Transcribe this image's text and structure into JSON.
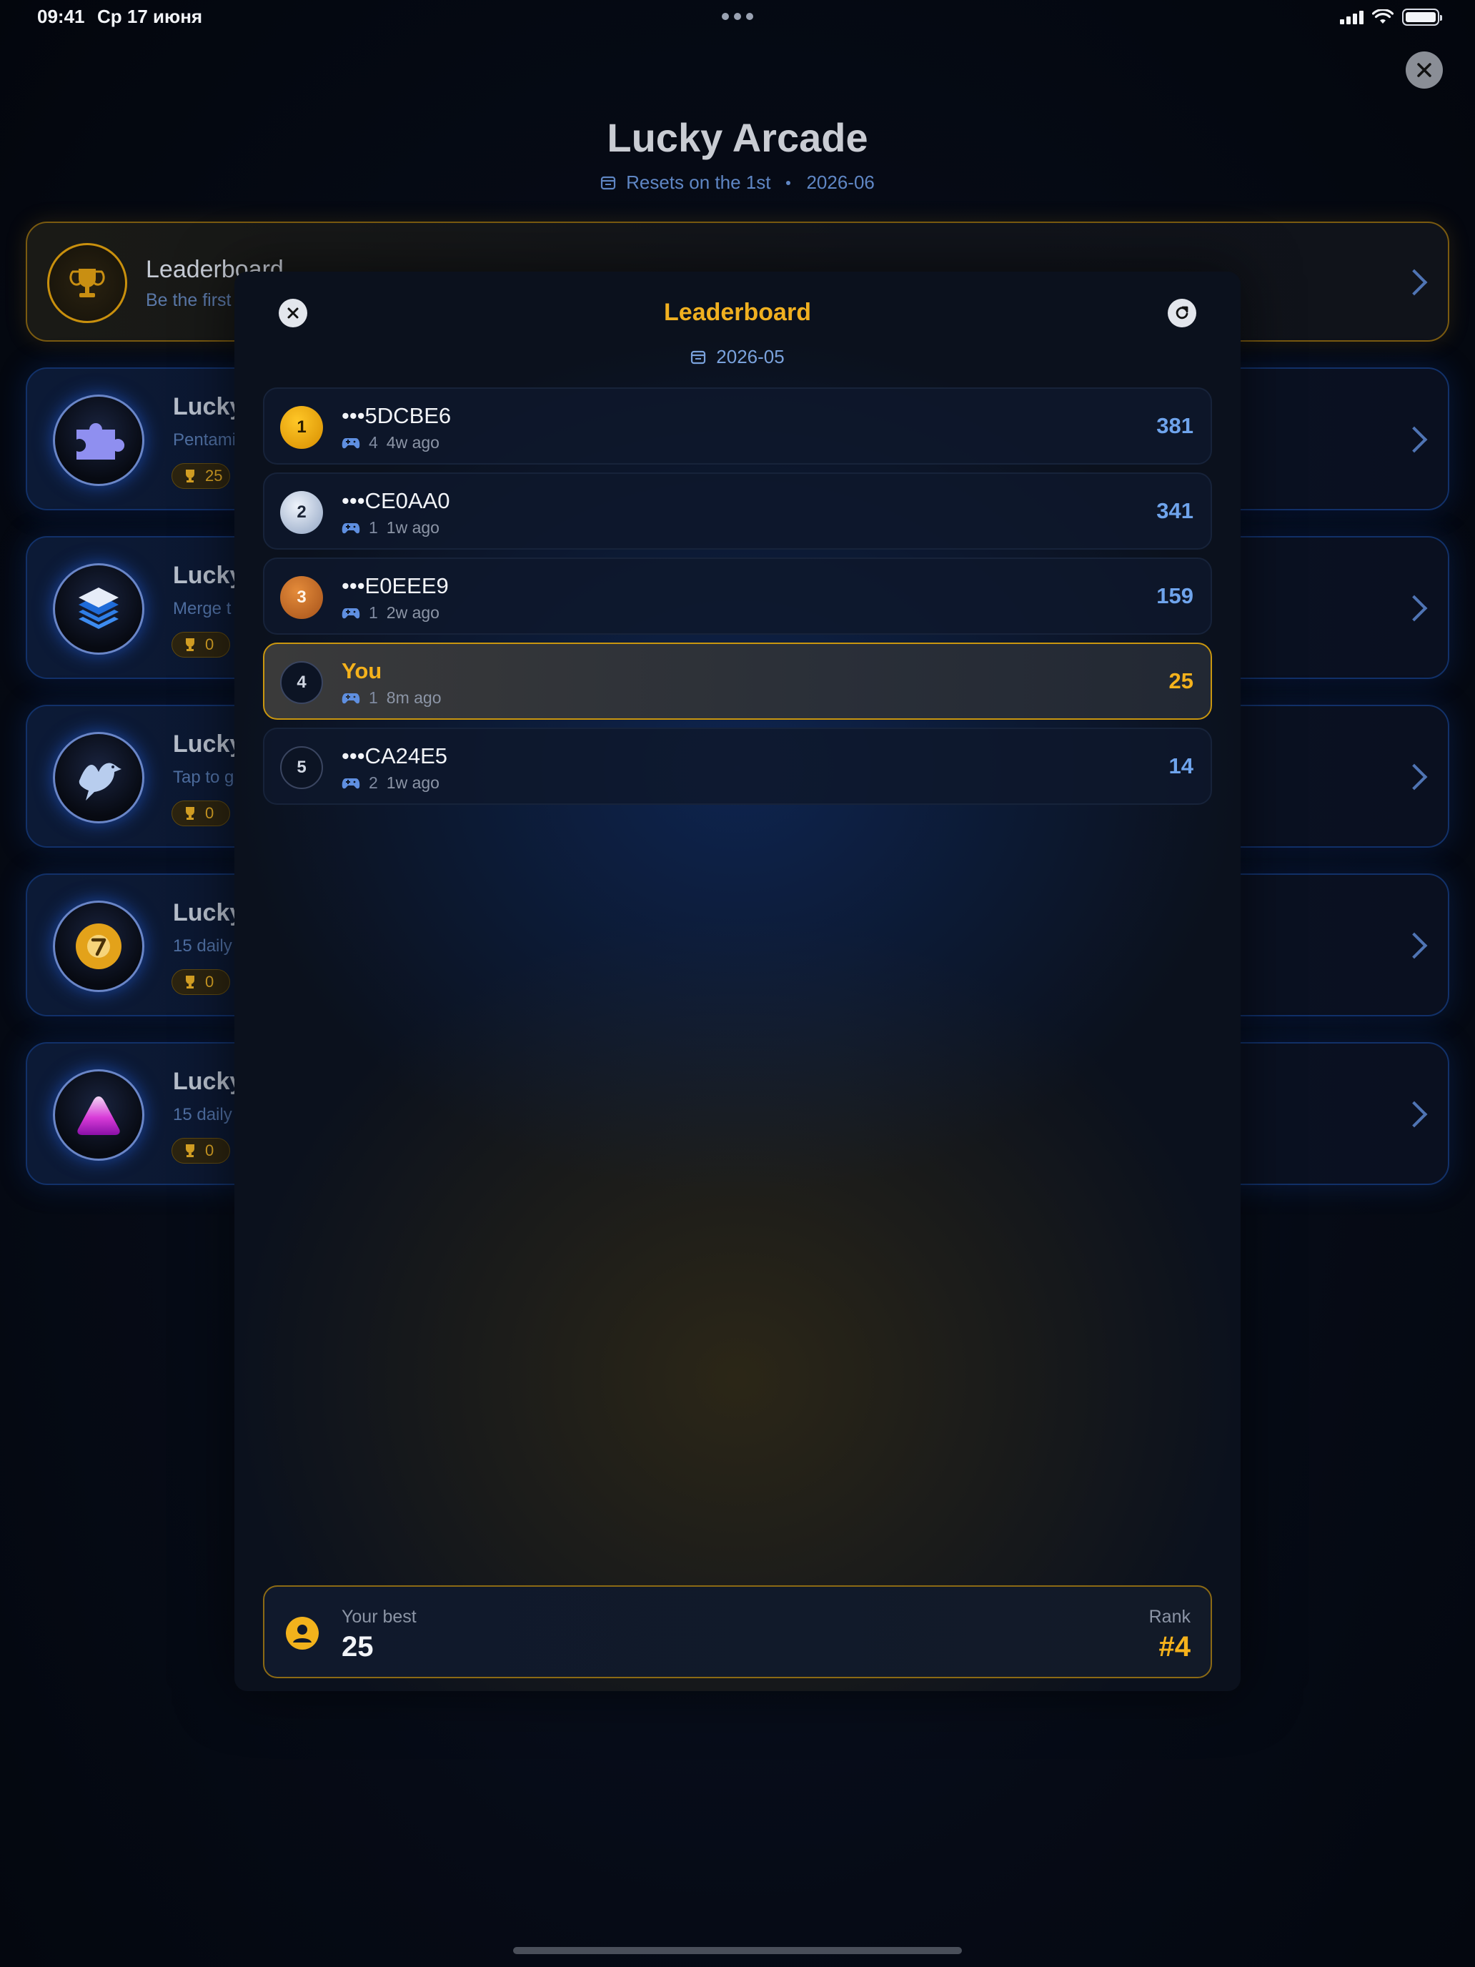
{
  "status_bar": {
    "time": "09:41",
    "date": "Ср 17 июня",
    "battery_level": 1.0
  },
  "page": {
    "title": "Lucky Arcade",
    "resets_label": "Resets on the 1st",
    "current_period": "2026-06"
  },
  "leaderboard_card": {
    "title": "Leaderboard",
    "subtitle": "Be the first"
  },
  "game_cards": [
    {
      "title": "Lucky",
      "subtitle": "Pentami",
      "trophies": "25",
      "icon": "puzzle-icon"
    },
    {
      "title": "Lucky",
      "subtitle": "Merge t",
      "trophies": "0",
      "icon": "layers-icon"
    },
    {
      "title": "Lucky",
      "subtitle": "Tap to g",
      "trophies": "0",
      "icon": "bird-icon"
    },
    {
      "title": "Lucky",
      "subtitle": "15 daily",
      "trophies": "0",
      "icon": "ball-seven-icon"
    },
    {
      "title": "Lucky",
      "subtitle": "15 daily",
      "trophies": "0",
      "icon": "triangle-icon"
    }
  ],
  "modal": {
    "title": "Leaderboard",
    "period": "2026-05",
    "entries": [
      {
        "rank": "1",
        "name": "•••5DCBE6",
        "games": "4",
        "ago": "4w ago",
        "score": "381"
      },
      {
        "rank": "2",
        "name": "•••CE0AA0",
        "games": "1",
        "ago": "1w ago",
        "score": "341"
      },
      {
        "rank": "3",
        "name": "•••E0EEE9",
        "games": "1",
        "ago": "2w ago",
        "score": "159"
      },
      {
        "rank": "4",
        "name": "You",
        "games": "1",
        "ago": "8m ago",
        "score": "25"
      },
      {
        "rank": "5",
        "name": "•••CA24E5",
        "games": "2",
        "ago": "1w ago",
        "score": "14"
      }
    ],
    "best": {
      "label": "Your best",
      "value": "25",
      "rank_label": "Rank",
      "rank_value": "#4"
    }
  },
  "colors": {
    "accent_gold": "#f5b21c",
    "score_blue": "#6fa4ec",
    "background": "#060b16"
  }
}
